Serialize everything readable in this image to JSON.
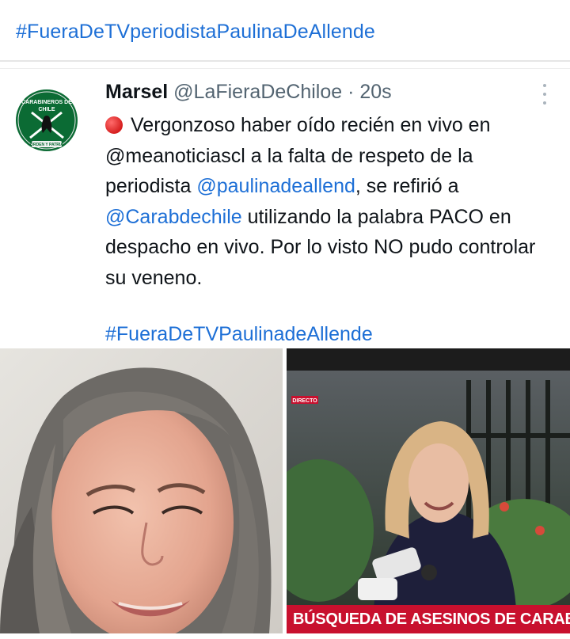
{
  "post": {
    "hashtag_title": "#FueraDeTVperiodistaPaulinaDeAllende"
  },
  "tweet": {
    "author_name": "Marsel",
    "author_handle": "@LaFieraDeChiloe",
    "separator": " · ",
    "time": "20s",
    "avatar_text": {
      "line1": "CARABINEROS DE",
      "line2": "CHILE",
      "ribbon": "ORDEN Y PATRIA"
    },
    "text": {
      "part1": "Vergonzoso haber oído recién en vivo en @meanoticiascl a la falta de respeto de la periodista ",
      "mention1": "@paulinadeallend",
      "part2": ", se refirió a ",
      "mention2": "@Carabdechile",
      "part3": " utilizando la palabra PACO en despacho en vivo. Por lo visto NO pudo controlar su veneno."
    },
    "hashtag": "#FueraDeTVPaulinadeAllende"
  },
  "images": {
    "right_banner": "BÚSQUEDA DE ASESINOS DE CARABINE",
    "right_tag": "DIRECTO"
  },
  "colors": {
    "link": "#1d6fd6",
    "emblem_green": "#0b6b34",
    "banner_red": "#c8102e"
  }
}
